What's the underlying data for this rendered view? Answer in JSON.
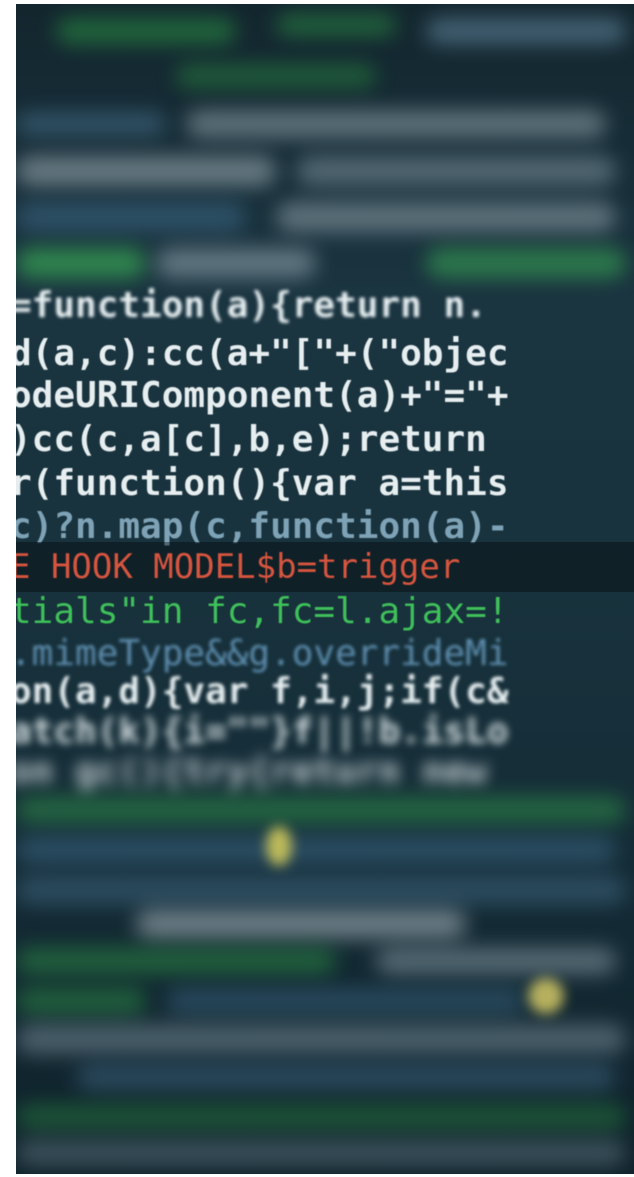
{
  "photo": {
    "subject": "code-screen",
    "code_lines": [
      {
        "text": "=function(a){return n.",
        "tone": "white"
      },
      {
        "text": "d(a,c):cc(a+\"[\"+(\"objec",
        "tone": "mixed"
      },
      {
        "text": "odeURIComponent(a)+\"=\"+",
        "tone": "white"
      },
      {
        "text": ")cc(c,a[c],b,e);return",
        "tone": "white"
      },
      {
        "text": "r(function(){var a=this",
        "tone": "white"
      },
      {
        "text": "c)?n.map(c,function(a)-",
        "tone": "mixed"
      },
      {
        "text": "E HOOK MODEL$b=trigger",
        "tone": "red"
      },
      {
        "text": "tials\"in fc,fc=l.ajax=!",
        "tone": "mixed"
      },
      {
        "text": ".mimeType&&g.overrideMi",
        "tone": "blue"
      },
      {
        "text": "on(a,d){var f,i,j;if(c&",
        "tone": "mixed"
      },
      {
        "text": "atch(k){i=\"\"}f||!b.isLo",
        "tone": "mixed"
      },
      {
        "text": "on gc(){try{return new",
        "tone": "mixed"
      }
    ]
  },
  "colors": {
    "background": "#17303b",
    "code_white": "#e6eef0",
    "code_blue": "#5f8fb0",
    "code_green": "#3fc05a",
    "code_red": "#d6553f"
  }
}
